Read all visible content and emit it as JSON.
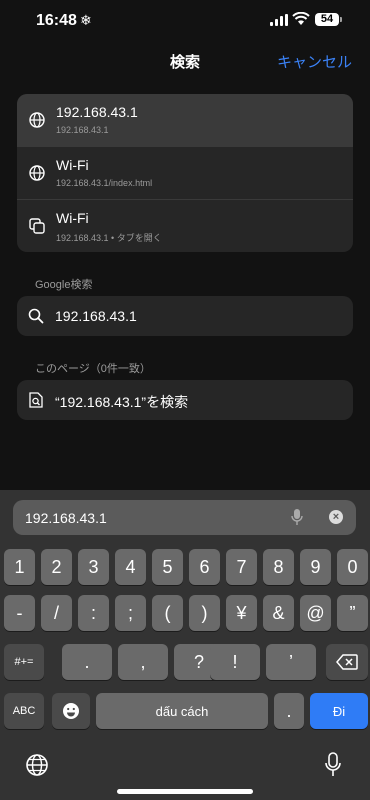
{
  "status": {
    "time": "16:48",
    "battery": "54"
  },
  "header": {
    "title": "検索",
    "cancel": "キャンセル"
  },
  "suggestions": [
    {
      "title": "192.168.43.1",
      "subtitle": "192.168.43.1",
      "icon": "globe-icon"
    },
    {
      "title": "Wi-Fi",
      "subtitle": "192.168.43.1/index.html",
      "icon": "globe-icon"
    },
    {
      "title": "Wi-Fi",
      "subtitle": "192.168.43.1 • タブを開く",
      "icon": "tabs-icon"
    }
  ],
  "google": {
    "header": "Google検索",
    "query": "192.168.43.1"
  },
  "page": {
    "header": "このページ（0件一致）",
    "find": "“192.168.43.1”を検索"
  },
  "keyboard": {
    "search_value": "192.168.43.1",
    "row1": [
      "1",
      "2",
      "3",
      "4",
      "5",
      "6",
      "7",
      "8",
      "9",
      "0"
    ],
    "row2": [
      "-",
      "/",
      ":",
      ";",
      "(",
      ")",
      "¥",
      "&",
      "@",
      "”"
    ],
    "row3": [
      ".",
      ",",
      "?",
      "!",
      "’"
    ],
    "switch_symbols": "#+=",
    "abc": "ABC",
    "space": "dấu cách",
    "period": ".",
    "go": "Đi"
  }
}
